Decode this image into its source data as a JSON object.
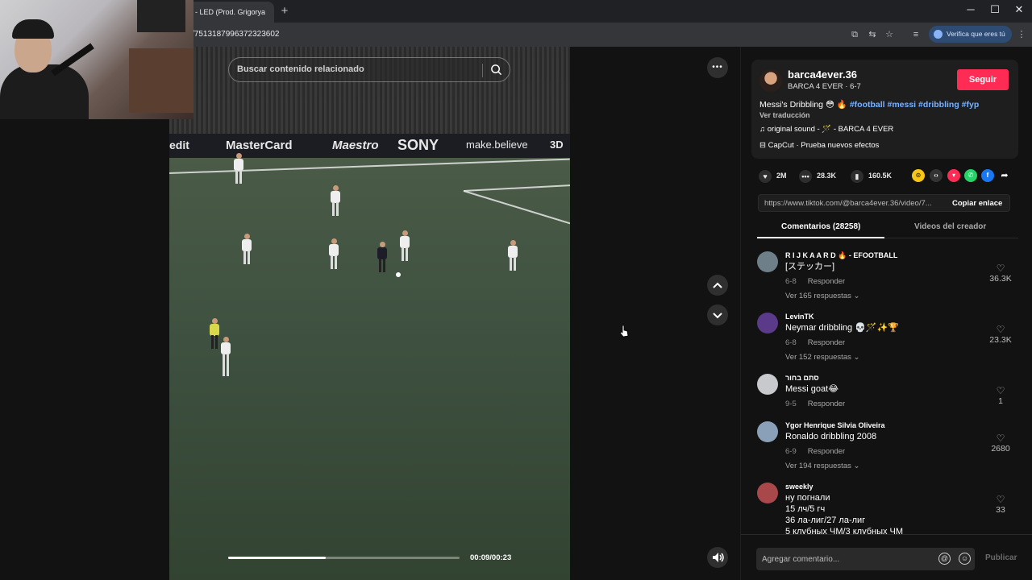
{
  "browser": {
    "tab_title": "- LED (Prod. Grigorya",
    "new_tab": "+",
    "url": "/7513187996372323602",
    "verify_label": "Verifica que eres tú",
    "win_min": "─",
    "win_max": "☐",
    "win_close": "✕"
  },
  "player": {
    "search_placeholder": "Buscar contenido relacionado",
    "time": "00:09/00:23",
    "progress": 0.42,
    "more": "•••",
    "ad_texts": [
      "edit",
      "MasterCard",
      "Maestro",
      "SONY",
      "make.believe",
      "3D"
    ]
  },
  "panel": {
    "username": "barca4ever.36",
    "subline": "BARCA 4 EVER · 6-7",
    "follow": "Seguir",
    "desc_text": "Messi's Dribbling 😳 🔥 ",
    "desc_tags": "#football #messi #dribbling #fyp",
    "translate": "Ver traducción",
    "sound": "♫  original sound - 🪄 - BARCA 4 EVER",
    "effect": "⊟  CapCut · Prueba nuevos efectos",
    "likes": "2M",
    "comments_count": "28.3K",
    "saves": "160.5K",
    "link": "https://www.tiktok.com/@barca4ever.36/video/7...",
    "copy_link": "Copiar enlace",
    "tab_comments": "Comentarios (28258)",
    "tab_creator": "Videos del creador",
    "input_placeholder": "Agregar comentario...",
    "publish": "Publicar"
  },
  "comments": [
    {
      "name": "R I J K A A R D 🔥 - EFOOTBALL",
      "text": "[ステッカー]",
      "date": "6-8",
      "reply": "Responder",
      "replies": "Ver 165 respuestas ⌄",
      "likes": "36.3K",
      "color": "#6f7f8a"
    },
    {
      "name": "LevinTK",
      "text": "Neymar dribbling 💀🪄✨🏆",
      "date": "6-8",
      "reply": "Responder",
      "replies": "Ver 152 respuestas ⌄",
      "likes": "23.3K",
      "color": "#5b3a8a"
    },
    {
      "name": "סתם בחור",
      "text": "Messi goat😂",
      "date": "9-5",
      "reply": "Responder",
      "replies": "",
      "likes": "1",
      "color": "#c7c9cc"
    },
    {
      "name": "Ygor Henrique Silvia Oliveira",
      "text": "Ronaldo dribbling 2008",
      "date": "6-9",
      "reply": "Responder",
      "replies": "Ver 194 respuestas ⌄",
      "likes": "2680",
      "color": "#8aa0b8"
    },
    {
      "name": "sweekly",
      "text": "ну погнали\n15 лч/5 гч\n36 ла-лиг/27 ла-лиг\n5 клубных ЧМ/3 клубных ЧМ",
      "date": "",
      "reply": "",
      "replies": "",
      "likes": "33",
      "color": "#a8484a"
    }
  ]
}
